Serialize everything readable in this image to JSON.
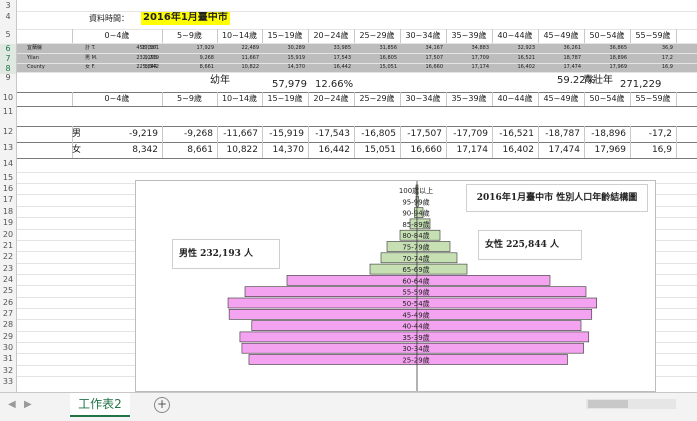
{
  "header": {
    "label": "資料時間：",
    "date": "2016年1月臺中市"
  },
  "age_groups": [
    "0~4歲",
    "5~9歲",
    "10~14歲",
    "15~19歲",
    "20~24歲",
    "25~29歲",
    "30~34歲",
    "35~39歲",
    "40~44歲",
    "45~49歲",
    "50~54歲",
    "55~59歲"
  ],
  "gray_rows": {
    "region": [
      "宜蘭縣",
      "Yilan",
      "County"
    ],
    "labels": [
      "計 T.",
      "男 M.",
      "女 F."
    ],
    "totals": [
      "458,037",
      "232,193",
      "225,844"
    ],
    "T": [
      "17,561",
      "17,929",
      "22,489",
      "30,289",
      "33,985",
      "31,856",
      "34,167",
      "34,883",
      "32,923",
      "36,261",
      "36,865",
      "36,9"
    ],
    "M": [
      "9,219",
      "9,268",
      "11,667",
      "15,919",
      "17,543",
      "16,805",
      "17,507",
      "17,709",
      "16,521",
      "18,787",
      "18,896",
      "17,2"
    ],
    "F": [
      "8,342",
      "8,661",
      "10,822",
      "14,370",
      "16,442",
      "15,051",
      "16,660",
      "17,174",
      "16,402",
      "17,474",
      "17,969",
      "16,9"
    ]
  },
  "row9": {
    "youth_label": "幼年",
    "youth_value": "57,979",
    "youth_pct": "12.66%",
    "adult_pct": "59.22%",
    "adult_label": "青壯年",
    "adult_value": "271,229"
  },
  "male": {
    "label": "男",
    "values": [
      "-9,219",
      "-9,268",
      "-11,667",
      "-15,919",
      "-17,543",
      "-16,805",
      "-17,507",
      "-17,709",
      "-16,521",
      "-18,787",
      "-18,896",
      "-17,2"
    ]
  },
  "female": {
    "label": "女",
    "values": [
      "8,342",
      "8,661",
      "10,822",
      "14,370",
      "16,442",
      "15,051",
      "16,660",
      "17,174",
      "16,402",
      "17,474",
      "17,969",
      "16,9"
    ]
  },
  "row_numbers": [
    "3",
    "4",
    "5",
    "6",
    "7",
    "8",
    "9",
    "10",
    "11",
    "12",
    "13",
    "14",
    "15",
    "16",
    "17",
    "18",
    "19",
    "20",
    "21",
    "22",
    "23",
    "24",
    "25",
    "26",
    "27",
    "28",
    "29",
    "30",
    "31",
    "32",
    "33"
  ],
  "chart_data": {
    "type": "bar",
    "title": "2016年1月臺中市 性別人口年齡結構圖",
    "male_box": "男性 232,193 人",
    "female_box": "女性 225,844 人",
    "categories": [
      "100歲以上",
      "95-99歲",
      "90-94歲",
      "85-89歲",
      "80-84歲",
      "75-79歲",
      "70-74歲",
      "65-69歲",
      "60-64歲",
      "55-59歲",
      "50-54歲",
      "45-49歲",
      "40-44歲",
      "35-39歲",
      "30-34歲",
      "25-29歲"
    ],
    "series": [
      {
        "values": [
          5,
          50,
          250,
          700,
          1700,
          3000,
          3600,
          4700,
          13000,
          17200,
          18896,
          18787,
          16521,
          17709,
          17507,
          16805
        ]
      },
      {
        "values": [
          20,
          150,
          600,
          1300,
          2300,
          3300,
          4000,
          5000,
          13300,
          16900,
          17969,
          17474,
          16402,
          17174,
          16660,
          15051
        ]
      }
    ],
    "colors": {
      "old_age": "#c6e0b4",
      "working_age": "#f4a3f0",
      "stroke": "#333333"
    }
  },
  "tabs": {
    "sheet_name": "工作表2",
    "add_label": "+"
  }
}
